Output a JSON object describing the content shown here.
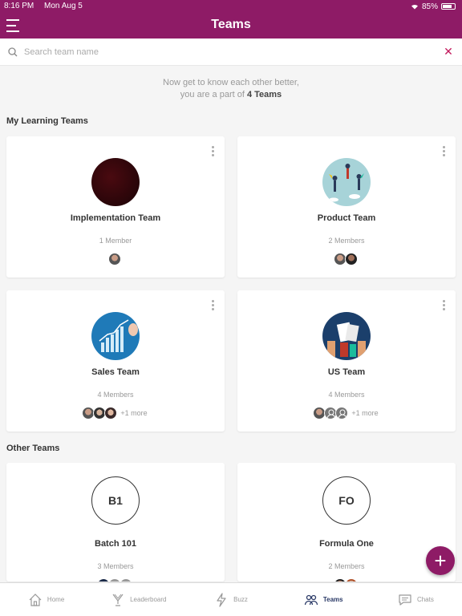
{
  "status": {
    "time": "8:16 PM",
    "date": "Mon Aug 5",
    "battery": "85%"
  },
  "header": {
    "title": "Teams"
  },
  "search": {
    "placeholder": "Search team name"
  },
  "intro": {
    "line1": "Now get to know each other better,",
    "line2_prefix": "you are a part of ",
    "line2_bold": "4 Teams"
  },
  "sections": {
    "my_teams": "My Learning Teams",
    "other_teams": "Other Teams"
  },
  "my_teams": [
    {
      "name": "Implementation Team",
      "count": "1 Member",
      "more": ""
    },
    {
      "name": "Product Team",
      "count": "2 Members",
      "more": ""
    },
    {
      "name": "Sales Team",
      "count": "4 Members",
      "more": "+1 more"
    },
    {
      "name": "US Team",
      "count": "4 Members",
      "more": "+1 more"
    }
  ],
  "other_teams": [
    {
      "initials": "B1",
      "name": "Batch 101",
      "count": "3 Members"
    },
    {
      "initials": "FO",
      "name": "Formula One",
      "count": "2 Members"
    }
  ],
  "tabs": [
    {
      "label": "Home",
      "icon": "home-icon",
      "active": false
    },
    {
      "label": "Leaderboard",
      "icon": "trophy-icon",
      "active": false
    },
    {
      "label": "Buzz",
      "icon": "lightning-icon",
      "active": false
    },
    {
      "label": "Teams",
      "icon": "people-icon",
      "active": true
    },
    {
      "label": "Chats",
      "icon": "chat-icon",
      "active": false
    }
  ],
  "colors": {
    "brand": "#8e1b66",
    "active_tab": "#2b3a67",
    "clear": "#c2185b"
  }
}
